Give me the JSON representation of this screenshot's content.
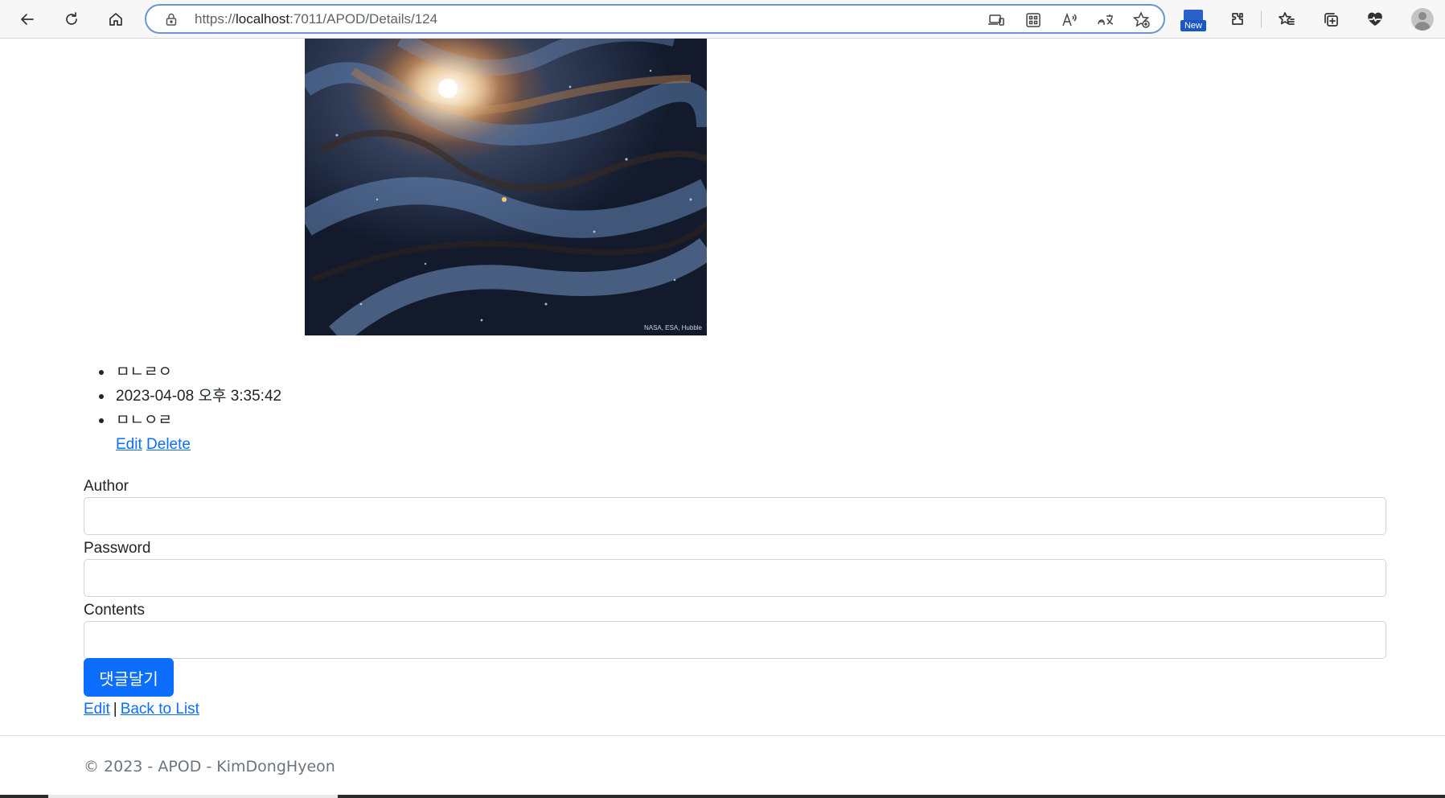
{
  "browser": {
    "url_scheme": "https://",
    "url_host": "localhost",
    "url_rest": ":7011/APOD/Details/124",
    "new_badge": "New",
    "icons": [
      "back-icon",
      "refresh-icon",
      "home-icon",
      "lock-icon",
      "device-icon",
      "apps-icon",
      "read-aloud-icon",
      "translate-icon",
      "add-favorite-icon",
      "extensions-icon",
      "favorites-icon",
      "collections-icon",
      "health-icon",
      "profile-icon"
    ]
  },
  "post": {
    "image_credit": "NASA, ESA, Hubble",
    "title": "ㅁㄴㄹㅇ",
    "date": "2023-04-08 오후 3:35:42",
    "content": "ㅁㄴㅇㄹ",
    "edit_label": "Edit",
    "delete_label": "Delete"
  },
  "comment_form": {
    "author_label": "Author",
    "author_value": "",
    "password_label": "Password",
    "password_value": "",
    "contents_label": "Contents",
    "contents_value": "",
    "submit_label": "댓글달기"
  },
  "bottom_nav": {
    "edit_label": "Edit",
    "separator": "|",
    "back_label": "Back to List"
  },
  "footer": {
    "text": "© 2023 - APOD - KimDongHyeon"
  },
  "colors": {
    "link": "#0d6efd",
    "primary_button": "#0d6efd",
    "footer_text": "#6c757d",
    "address_focus": "#6b94d6"
  }
}
